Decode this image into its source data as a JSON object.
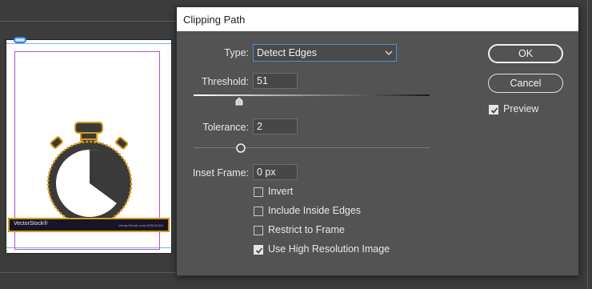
{
  "dialog": {
    "title": "Clipping Path",
    "type": {
      "label": "Type:",
      "value": "Detect Edges"
    },
    "threshold": {
      "label": "Threshold:",
      "value": "51"
    },
    "tolerance": {
      "label": "Tolerance:",
      "value": "2"
    },
    "inset_frame": {
      "label": "Inset Frame:",
      "value": "0 px"
    },
    "checkboxes": [
      {
        "label": "Invert",
        "checked": false
      },
      {
        "label": "Include Inside Edges",
        "checked": false
      },
      {
        "label": "Restrict to Frame",
        "checked": false
      },
      {
        "label": "Use High Resolution Image",
        "checked": true
      }
    ],
    "buttons": {
      "ok": "OK",
      "cancel": "Cancel"
    },
    "preview": {
      "label": "Preview",
      "checked": true
    }
  },
  "document": {
    "banner_left_text": "VectorStock®",
    "banner_right_text": "VectorStock.com/32541163"
  },
  "colors": {
    "dialog_bg": "#535353",
    "focus_border": "#4d8fd6",
    "selection_handles": "#d79a14",
    "margin_guides": "#b04fd3"
  }
}
